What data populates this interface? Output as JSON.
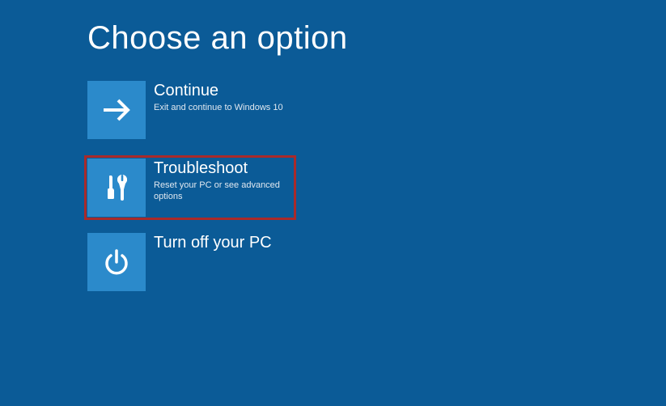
{
  "page": {
    "title": "Choose an option"
  },
  "options": {
    "continue": {
      "title": "Continue",
      "desc": "Exit and continue to Windows 10"
    },
    "troubleshoot": {
      "title": "Troubleshoot",
      "desc": "Reset your PC or see advanced options"
    },
    "turnoff": {
      "title": "Turn off your PC",
      "desc": ""
    }
  },
  "colors": {
    "background": "#0b5b97",
    "tile": "#2b8acb",
    "highlight_border": "#a92a2a"
  }
}
